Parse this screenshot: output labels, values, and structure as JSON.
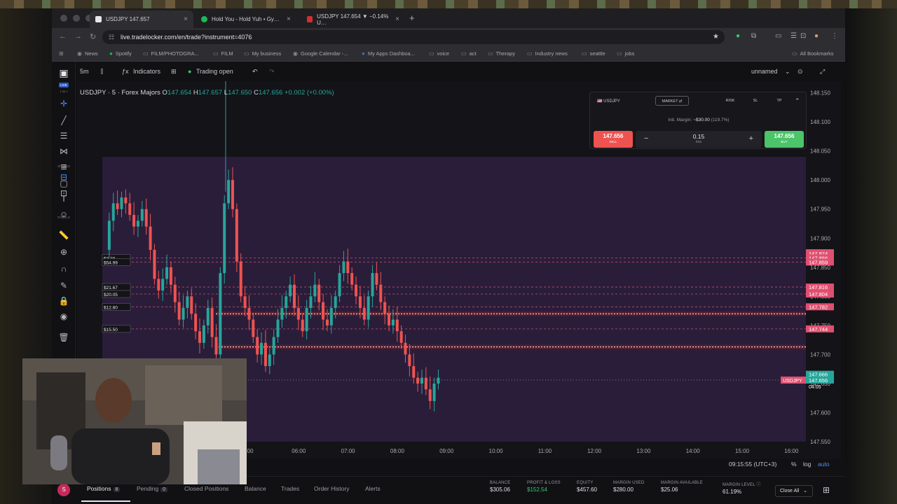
{
  "browser": {
    "tabs": [
      {
        "title": "USDJPY 147.657",
        "color": "#e8e8ec"
      },
      {
        "title": "Hold You - Hold Yuh • Gy…",
        "color": "#1db954"
      },
      {
        "title": "USDJPY 147.654 ▼ −0.14% U…",
        "color": "#d32f2f"
      }
    ],
    "url": "live.tradelocker.com/en/trade?instrument=4076",
    "bookmarks": [
      "News",
      "Spotify",
      "FILM/PHOTOGRA...",
      "FILM",
      "My business",
      "Google Calendar -...",
      "My Apps Dashboa...",
      "voice",
      "act",
      "Therapy",
      "Industry news",
      "seattle",
      "jobs"
    ],
    "all_bookmarks": "All Bookmarks"
  },
  "app": {
    "live_label": "LIVE",
    "version": "1.56.1",
    "spaces_label": "SPACES",
    "panels_label": "PANELS",
    "timeframe": "5m",
    "indicators": "Indicators",
    "trading_status": "Trading open",
    "layout_name": "unnamed"
  },
  "chart_header": {
    "symbol": "USDJPY · 5 · Forex Majors",
    "o_label": "O",
    "o": "147.654",
    "h_label": "H",
    "h": "147.657",
    "l_label": "L",
    "l": "147.650",
    "c_label": "C",
    "c": "147.656",
    "change": "+0.002 (+0.00%)"
  },
  "order_panel": {
    "symbol": "USDJPY",
    "order_type": "MARKET",
    "risk": "RISK",
    "sl": "SL",
    "tp": "TP",
    "margin_label": "Init. Margin:",
    "margin_value": "~$30.00",
    "margin_pct": "(119.7%)",
    "sell_price": "147.656",
    "sell_label": "SELL",
    "buy_price": "147.656",
    "buy_label": "BUY",
    "lots": "0.15",
    "lots_label": "lots",
    "minus": "−",
    "plus": "+"
  },
  "chart_data": {
    "type": "candlestick",
    "price_axis": [
      "148.150",
      "148.100",
      "148.050",
      "148.000",
      "147.950",
      "147.900",
      "147.850",
      "147.800",
      "147.750",
      "147.700",
      "147.650",
      "147.600",
      "147.550"
    ],
    "time_axis": [
      "5:00",
      "06:00",
      "07:00",
      "08:00",
      "09:00",
      "10:00",
      "11:00",
      "12:00",
      "13:00",
      "14:00",
      "15:00",
      "16:00"
    ],
    "price_tags": [
      "147.875",
      "147.874",
      "147.866",
      "147.859",
      "147.816",
      "147.804",
      "147.782",
      "147.744",
      "147.666",
      "147.656"
    ],
    "last_price": "147.656",
    "countdown": "04:05",
    "symbol_tag": "USDJPY",
    "order_lines": [
      {
        "label": "$3.38",
        "price": 147.866
      },
      {
        "label": "$54.99",
        "price": 147.859
      },
      {
        "label": "$21.67",
        "price": 147.816
      },
      {
        "label": "$20.05",
        "price": 147.804
      },
      {
        "label": "$12.80",
        "price": 147.782
      },
      {
        "label": "$15.50",
        "price": 147.744
      }
    ],
    "ylim": [
      147.55,
      148.17
    ],
    "bg_color": "#2a1d3a",
    "up_color": "#26a69a",
    "down_color": "#ef5350"
  },
  "status": {
    "time": "09:15:55 (UTC+3)",
    "pct": "%",
    "log": "log",
    "auto": "auto"
  },
  "bottom": {
    "avatar": "S",
    "tabs": [
      {
        "label": "Positions",
        "badge": "8"
      },
      {
        "label": "Pending",
        "badge": "0"
      },
      {
        "label": "Closed Positions",
        "badge": ""
      },
      {
        "label": "Balance",
        "badge": ""
      },
      {
        "label": "Trades",
        "badge": ""
      },
      {
        "label": "Order History",
        "badge": ""
      },
      {
        "label": "Alerts",
        "badge": ""
      }
    ],
    "stats": [
      {
        "label": "BALANCE",
        "value": "$305.06"
      },
      {
        "label": "PROFIT & LOSS",
        "value": "$152.54"
      },
      {
        "label": "EQUITY",
        "value": "$457.60"
      },
      {
        "label": "MARGIN USED",
        "value": "$280.00"
      },
      {
        "label": "MARGIN AVAILABLE",
        "value": "$25.06"
      },
      {
        "label": "MARGIN LEVEL",
        "value": "61.19%"
      }
    ],
    "close_all": "Close All"
  }
}
